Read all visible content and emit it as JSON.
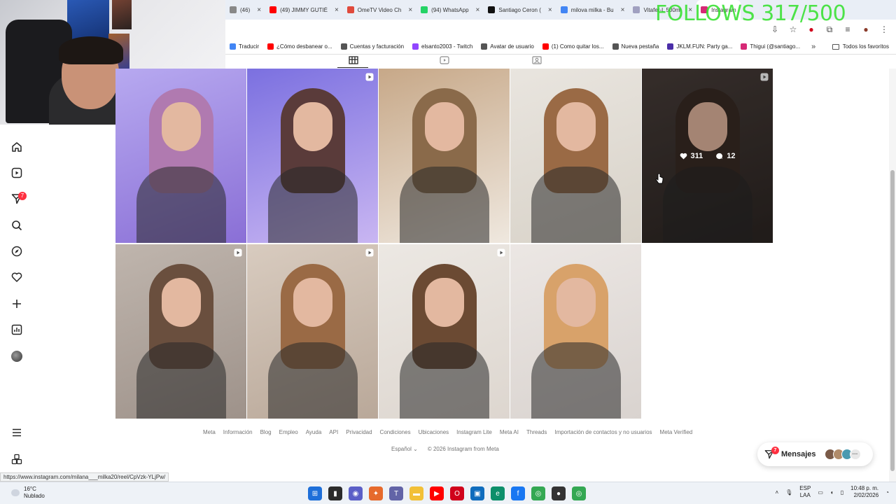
{
  "browser": {
    "tabs": [
      {
        "title": "(46)",
        "color": "#888888",
        "active": false
      },
      {
        "title": "(49) JIMMY GUTIÉ",
        "color": "#ff0000",
        "active": false
      },
      {
        "title": "OmeTV Video Ch",
        "color": "#e04a3c",
        "active": false
      },
      {
        "title": "(94) WhatsApp",
        "color": "#25d366",
        "active": false
      },
      {
        "title": "Santiago Ceron (",
        "color": "#111111",
        "active": false
      },
      {
        "title": "milova milka - Bu",
        "color": "#4285f4",
        "active": false
      },
      {
        "title": "Vitafer-L 500ml",
        "color": "#a0a0c0",
        "active": false
      },
      {
        "title": "Instagram",
        "color": "#d62976",
        "active": true
      }
    ],
    "tab_close": "×",
    "bookmarks": [
      {
        "label": "Traducir",
        "color": "#4285f4"
      },
      {
        "label": "¿Cómo desbanear o...",
        "color": "#ff0000"
      },
      {
        "label": "Cuentas y facturación",
        "color": "#555555"
      },
      {
        "label": "elsanto2003 - Twitch",
        "color": "#9146ff"
      },
      {
        "label": "Avatar de usuario",
        "color": "#555555"
      },
      {
        "label": "(1) Como quitar los...",
        "color": "#ff0000"
      },
      {
        "label": "Nueva pestaña",
        "color": "#555555"
      },
      {
        "label": "JKLM.FUN: Party ga...",
        "color": "#4b2ea8"
      },
      {
        "label": "Thigui (@santiago...",
        "color": "#d62976"
      }
    ],
    "bookmarks_more": "»",
    "all_bookmarks": "Todos los favoritos"
  },
  "overlay": {
    "follows_text": "FOLLOWS 317/500"
  },
  "sidebar": {
    "icons": [
      "home-icon",
      "reels-icon",
      "direct-icon",
      "search-icon",
      "explore-icon",
      "heart-icon",
      "create-icon",
      "dashboard-icon",
      "profile-avatar",
      "menu-icon",
      "threads-icon"
    ],
    "notification_badge": "7"
  },
  "posts": [
    {
      "reel": false,
      "bg": [
        "#b7a9f0",
        "#8a6fd6"
      ],
      "hair": "#b07ab0"
    },
    {
      "reel": true,
      "bg": [
        "#7b70e0",
        "#c9b6f2"
      ],
      "hair": "#5a3b3a"
    },
    {
      "reel": false,
      "bg": [
        "#c7a888",
        "#efe8df"
      ],
      "hair": "#8a6a4a"
    },
    {
      "reel": false,
      "bg": [
        "#e9e5df",
        "#d8d2c8"
      ],
      "hair": "#9a6a45"
    },
    {
      "reel": true,
      "bg": [
        "#4a3f3b",
        "#2d2623"
      ],
      "hair": "#3a2b24",
      "likes": "311",
      "comments": "12"
    },
    {
      "reel": true,
      "bg": [
        "#bfb5ad",
        "#9e928a"
      ],
      "hair": "#6a4f3e"
    },
    {
      "reel": true,
      "bg": [
        "#d8cbbf",
        "#b9a899"
      ],
      "hair": "#9a6a45"
    },
    {
      "reel": true,
      "bg": [
        "#ece8e3",
        "#ddd6cf"
      ],
      "hair": "#6b4a33"
    },
    {
      "reel": false,
      "bg": [
        "#ece7e4",
        "#d9d3cf"
      ],
      "hair": "#d8a26a"
    }
  ],
  "footer": {
    "links": [
      "Meta",
      "Información",
      "Blog",
      "Empleo",
      "Ayuda",
      "API",
      "Privacidad",
      "Condiciones",
      "Ubicaciones",
      "Instagram Lite",
      "Meta AI",
      "Threads",
      "Importación de contactos y no usuarios",
      "Meta Verified"
    ],
    "language": "Español",
    "copyright": "© 2026 Instagram from Meta"
  },
  "messages": {
    "label": "Mensajes",
    "badge": "7"
  },
  "status_url": "https://www.instagram.com/milana___milka20/reel/CpVzk-YLjPw/",
  "taskbar": {
    "temperature": "16°C",
    "condition": "Nublado",
    "language_top": "ESP",
    "language_bottom": "LAA",
    "time": "10:48 p. m.",
    "date": "2/02/2026"
  },
  "colors": {
    "accent_red": "#ff3040",
    "overlay_green": "#31e02a",
    "text_muted": "#737373"
  }
}
